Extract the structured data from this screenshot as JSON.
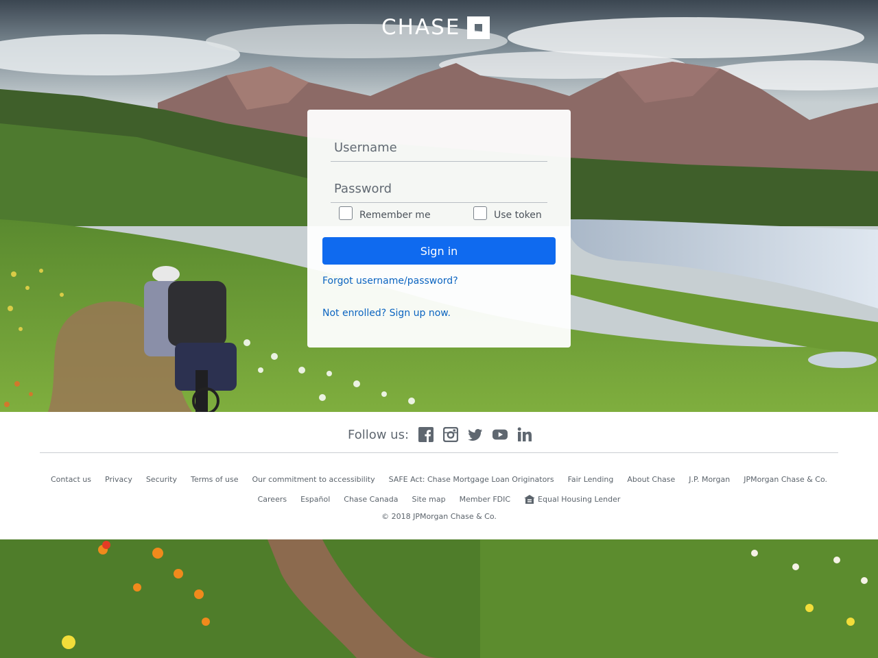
{
  "brand": {
    "name": "CHASE",
    "logo_icon": "chase-octagon-icon"
  },
  "login": {
    "username_placeholder": "Username",
    "password_placeholder": "Password",
    "remember_label": "Remember me",
    "token_label": "Use token",
    "signin_label": "Sign in",
    "forgot_link": "Forgot username/password?",
    "enroll_link": "Not enrolled? Sign up now."
  },
  "colors": {
    "primary_button": "#0f6aef",
    "link": "#0b64c0"
  },
  "footer": {
    "follow_label": "Follow us:",
    "social": [
      "facebook-icon",
      "instagram-icon",
      "twitter-icon",
      "youtube-icon",
      "linkedin-icon"
    ],
    "links_row1": [
      "Contact us",
      "Privacy",
      "Security",
      "Terms of use",
      "Our commitment to accessibility",
      "SAFE Act: Chase Mortgage Loan Originators",
      "Fair Lending",
      "About Chase",
      "J.P. Morgan",
      "JPMorgan Chase & Co."
    ],
    "links_row2": [
      "Careers",
      "Español",
      "Chase Canada",
      "Site map",
      "Member FDIC"
    ],
    "equal_housing": "Equal Housing Lender",
    "copyright": "© 2018 JPMorgan Chase & Co."
  }
}
